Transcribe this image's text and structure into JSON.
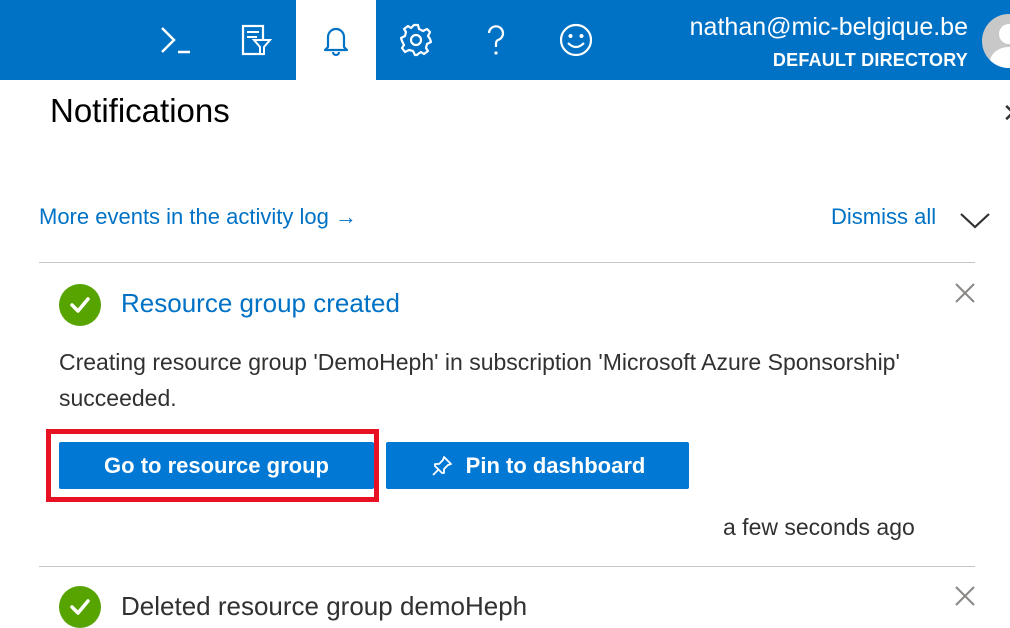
{
  "topbar": {
    "icons": [
      "cloud-shell-icon",
      "directory-filter-icon",
      "notifications-bell-icon",
      "settings-gear-icon",
      "help-icon",
      "feedback-smiley-icon"
    ],
    "account_name": "nathan@mic-belgique.be",
    "directory": "DEFAULT DIRECTORY",
    "accent": "#0072c6"
  },
  "panel": {
    "title": "Notifications",
    "activity_log_link": "More events in the activity log →",
    "dismiss_all": "Dismiss all"
  },
  "notifications": [
    {
      "status": "success",
      "title": "Resource group created",
      "description": "Creating resource group 'DemoHeph' in subscription 'Microsoft Azure Sponsorship' succeeded.",
      "primary_button": "Go to resource group",
      "secondary_button": "Pin to dashboard",
      "timestamp": "a few seconds ago"
    },
    {
      "status": "success",
      "title": "Deleted resource group demoHeph"
    }
  ],
  "colors": {
    "success": "#57a300",
    "link": "#0072c6",
    "button": "#0078d4",
    "highlight": "#e81123"
  }
}
